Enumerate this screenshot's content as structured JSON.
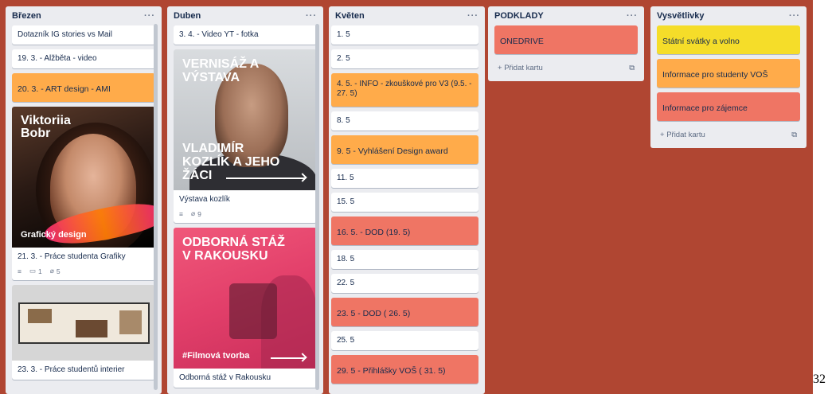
{
  "lists": [
    {
      "title": "Březen",
      "cards": [
        {
          "title": "Dotazník IG stories vs Mail"
        },
        {
          "title": "19. 3. - Alžběta - video"
        },
        {
          "title": "20. 3. - ART design - AMI",
          "color": "#ffab4a"
        },
        {
          "title": "21. 3. - Práce studenta Grafiky",
          "cover_title_lines": [
            "Viktoriia",
            "Bobr"
          ],
          "cover_caption": "Grafický design",
          "badges": {
            "comments": "1",
            "attachments": "5"
          }
        },
        {
          "title": "23. 3. - Práce studentů interier"
        }
      ]
    },
    {
      "title": "Duben",
      "cards": [
        {
          "title": "3. 4. - Video YT - fotka"
        },
        {
          "title": "Výstava kozlík",
          "cover_top_lines": [
            "VERNISÁŽ A",
            "VÝSTAVA"
          ],
          "cover_bottom_lines": [
            "VLADIMÍR",
            "KOZLÍK A JEHO",
            "ŽÁCI"
          ],
          "badges": {
            "attachments": "9"
          }
        },
        {
          "title": "Odborná stáž v Rakousku",
          "cover_top_lines": [
            "ODBORNÁ STÁŽ",
            "V RAKOUSKU"
          ],
          "cover_caption": "#Filmová tvorba"
        }
      ]
    },
    {
      "title": "Květen",
      "cards": [
        {
          "title": "1. 5"
        },
        {
          "title": "2. 5"
        },
        {
          "title": "4. 5. - INFO - zkouškové pro V3 (9.5. - 27. 5)",
          "color": "#ffab4a"
        },
        {
          "title": "8. 5"
        },
        {
          "title": "9. 5 - Vyhlášení Design award",
          "color": "#ffab4a"
        },
        {
          "title": "11. 5"
        },
        {
          "title": "15. 5"
        },
        {
          "title": "16. 5. - DOD (19. 5)",
          "color": "#ef7564"
        },
        {
          "title": "18. 5"
        },
        {
          "title": "22. 5"
        },
        {
          "title": "23. 5 - DOD ( 26. 5)",
          "color": "#ef7564"
        },
        {
          "title": "25. 5"
        },
        {
          "title": "29. 5 - Přihlášky VOŠ ( 31. 5)",
          "color": "#ef7564"
        }
      ]
    },
    {
      "title": "PODKLADY",
      "cards": [
        {
          "title": "ONEDRIVE",
          "color": "#ef7564"
        }
      ],
      "add_card": "Přidat kartu"
    },
    {
      "title": "Vysvětlivky",
      "cards": [
        {
          "title": "Státní svátky a volno",
          "color": "#f5dd29"
        },
        {
          "title": "Informace pro studenty VOŠ",
          "color": "#ffab4a"
        },
        {
          "title": "Informace pro zájemce",
          "color": "#ef7564"
        }
      ],
      "add_card": "Přidat kartu"
    }
  ],
  "list_menu_label": "···",
  "page_number": "32",
  "colors": {
    "board": "#b04632",
    "list": "#ebecf0",
    "orange": "#ffab4a",
    "salmon": "#ef7564",
    "yellow": "#f5dd29"
  }
}
